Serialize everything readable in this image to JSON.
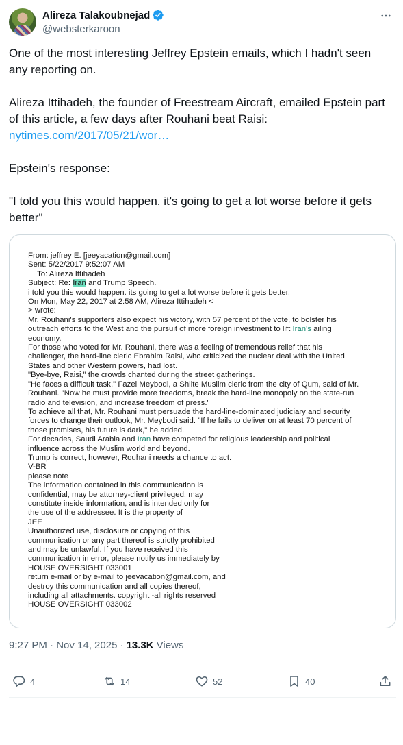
{
  "author": {
    "display_name": "Alireza Talakoubnejad",
    "handle": "@websterkaroon",
    "verified_icon": "verified-badge-icon"
  },
  "tweet": {
    "para1": "One of the most interesting Jeffrey Epstein emails, which I hadn't seen any reporting on.",
    "para2": "Alireza Ittihadeh, the founder of Freestream Aircraft, emailed Epstein part of this article, a few days after Rouhani beat Raisi:",
    "link": "nytimes.com/2017/05/21/wor…",
    "para3": "Epstein's response:",
    "para4": "\"I told you this would happen. it's going to get a lot worse before it gets better\""
  },
  "document": {
    "from": "From: jeffrey E. [jeeyacation@gmail.com]",
    "sent": "Sent: 5/22/2017 9:52:07 AM",
    "to": "To: Alireza Ittihadeh",
    "subject_pre": "Subject: Re: ",
    "subject_hl": "Iran",
    "subject_post": " and Trump Speech.",
    "l1": "i told you this would happen. its going to get a lot worse before it gets better.",
    "l2": "On Mon, May 22, 2017 at 2:58 AM, Alireza Ittihadeh <",
    "l3": "> wrote:",
    "l4": "Mr. Rouhani's supporters also expect his victory, with 57 percent of the vote, to bolster his",
    "l5_pre": "outreach efforts to the West and the pursuit of more foreign investment to lift ",
    "l5_hl": "Iran's",
    "l5_post": " ailing",
    "l6": "economy.",
    "l7": "For those who voted for Mr. Rouhani, there was a feeling of tremendous relief that his",
    "l8": "challenger, the hard-line cleric Ebrahim Raisi, who criticized the nuclear deal with the United",
    "l9": "States and other Western powers, had lost.",
    "l10": "\"Bye-bye, Raisi,\" the crowds chanted during the street gatherings.",
    "l11": "\"He faces a difficult task,\" Fazel Meybodi, a Shiite Muslim cleric from the city of Qum, said of Mr.",
    "l12": "Rouhani. \"Now he must provide more freedoms, break the hard-line monopoly on the state-run",
    "l13": "radio and television, and increase freedom of press.\"",
    "l14": "To achieve all that, Mr. Rouhani must persuade the hard-line-dominated judiciary and security",
    "l15": "forces to change their outlook, Mr. Meybodi said. \"If he fails to deliver on at least 70 percent of",
    "l16": "those promises, his future is dark,\" he added.",
    "l17_pre": "For decades, Saudi Arabia and ",
    "l17_hl": "Iran",
    "l17_post": " have competed for religious leadership and political",
    "l18": "influence across the Muslim world and beyond.",
    "l19": "Trump is correct, however, Rouhani needs a chance to act.",
    "l20": "V-BR",
    "l21": "please note",
    "l22": "The information contained in this communication is",
    "l23": "confidential, may be attorney-client privileged, may",
    "l24": "constitute inside information, and is intended only for",
    "l25": "the use of the addressee. It is the property of",
    "l26": "JEE",
    "l27": "Unauthorized use, disclosure or copying of this",
    "l28": "communication or any part thereof is strictly prohibited",
    "l29": "and may be unlawful. If you have received this",
    "l30": "communication in error, please notify us immediately by",
    "l31": "HOUSE OVERSIGHT 033001",
    "l32": "return e-mail or by e-mail to jeevacation@gmail.com, and",
    "l33": "destroy this communication and all copies thereof,",
    "l34": "including all attachments. copyright -all rights reserved",
    "l35": "HOUSE OVERSIGHT 033002"
  },
  "meta": {
    "timestamp": "9:27 PM · Nov 14, 2025 ·",
    "views_count": "13.3K",
    "views_label": "Views"
  },
  "actions": {
    "replies": "4",
    "reposts": "14",
    "likes": "52",
    "bookmarks": "40"
  },
  "colors": {
    "link": "#1d9bf0",
    "muted": "#536471",
    "highlight": "#6fe0c0"
  }
}
